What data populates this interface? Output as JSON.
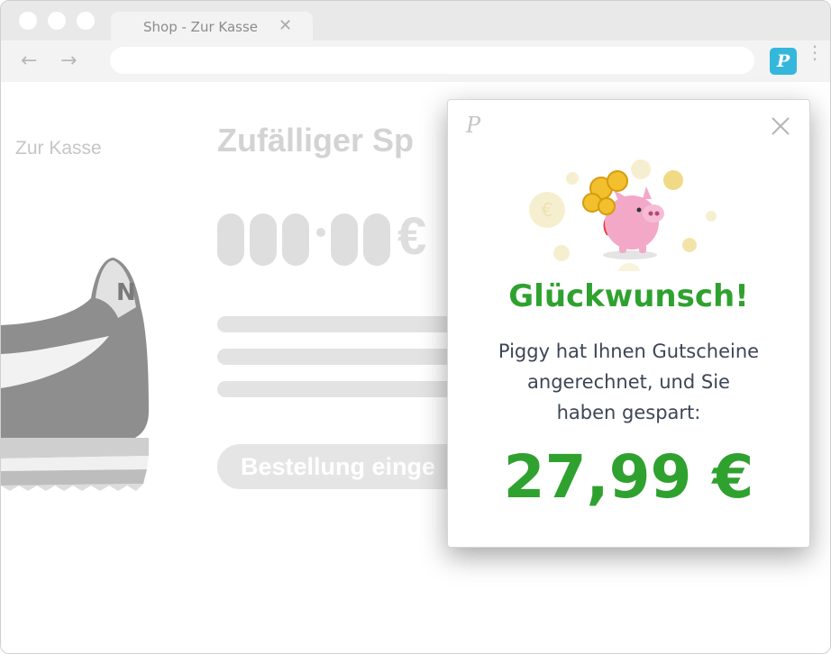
{
  "browser": {
    "tab_title": "Shop - Zur Kasse",
    "tab_close": "✕",
    "back": "←",
    "forward": "→",
    "address_value": "",
    "extension_label": "P",
    "menu": "⋮"
  },
  "shop": {
    "breadcrumb": "Zur Kasse",
    "product_title": "Zufälliger Sp",
    "price_currency": "€",
    "order_button": "Bestellung einge"
  },
  "popup": {
    "logo": "P",
    "heading": "Glückwunsch!",
    "message_line1": "Piggy hat Ihnen Gutscheine",
    "message_line2": "angerechnet, und Sie",
    "message_line3": "haben gespart:",
    "amount": "27,99 €",
    "coin_symbol": "€"
  },
  "colors": {
    "accent_green": "#2fa12f",
    "extension_blue": "#35b7dc",
    "text_dark": "#3d4655"
  }
}
